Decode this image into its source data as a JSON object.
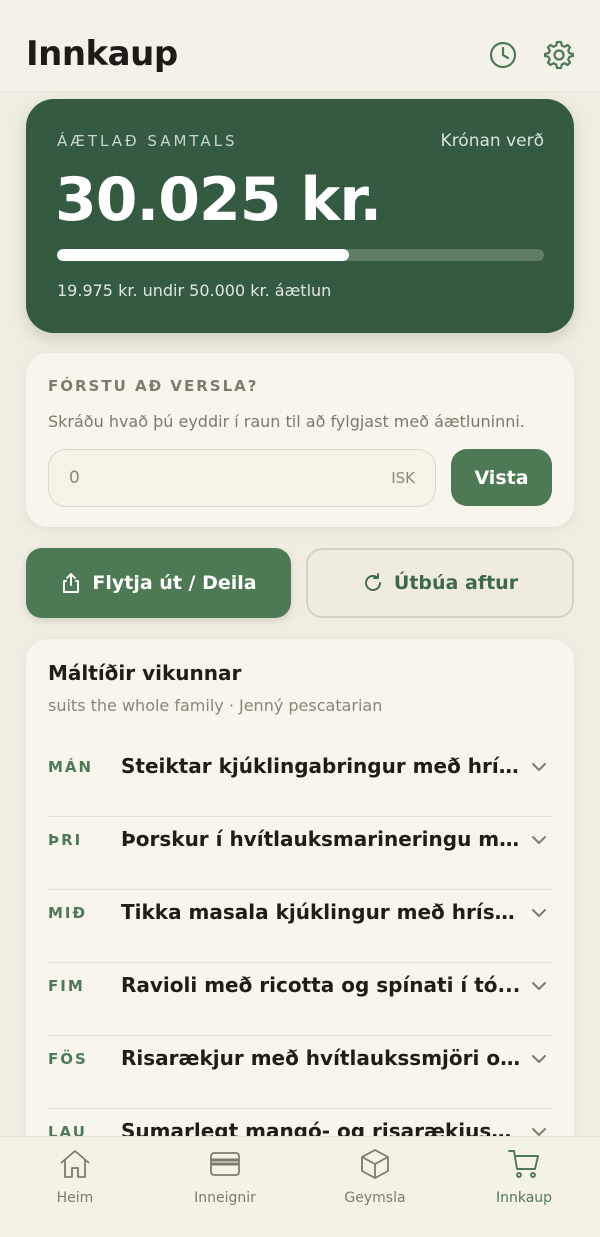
{
  "header": {
    "title": "Innkaup",
    "history_icon": "clock-icon",
    "settings_icon": "gear-icon"
  },
  "budget": {
    "label": "ÁÆTLAÐ SAMTALS",
    "store": "Krónan verð",
    "amount": "30.025 kr.",
    "progress_fraction": 0.6,
    "note": "19.975 kr. undir 50.000 kr. áætlun"
  },
  "spend": {
    "label": "FÓRSTU AÐ VERSLA?",
    "description": "Skráðu hvað þú eyddir í raun til að fylgjast með áætluninni.",
    "input_placeholder": "0",
    "unit": "ISK",
    "save_label": "Vista"
  },
  "actions": {
    "export_label": "Flytja út / Deila",
    "regenerate_label": "Útbúa aftur"
  },
  "meals": {
    "title": "Máltíðir vikunnar",
    "subtitle": "suits the whole family · Jenný pescatarian",
    "items": [
      {
        "day": "MÁN",
        "dish": "Steiktar kjúklingabringur með hrís..."
      },
      {
        "day": "ÞRI",
        "dish": "Þorskur í hvítlauksmarineringu m..."
      },
      {
        "day": "MIÐ",
        "dish": "Tikka masala kjúklingur með hrísg..."
      },
      {
        "day": "FIM",
        "dish": "Ravioli með ricotta og spínati í tó..."
      },
      {
        "day": "FÖS",
        "dish": "Risarækjur með hvítlaukssmjöri o..."
      },
      {
        "day": "LAU",
        "dish": "Sumarlegt mangó- og risarækjusa..."
      }
    ]
  },
  "nav": {
    "items": [
      {
        "label": "Heim",
        "icon": "home-icon",
        "active": false
      },
      {
        "label": "Inneignir",
        "icon": "card-icon",
        "active": false
      },
      {
        "label": "Geymsla",
        "icon": "box-icon",
        "active": false
      },
      {
        "label": "Innkaup",
        "icon": "cart-icon",
        "active": true
      }
    ]
  },
  "colors": {
    "accent": "#4d7a55",
    "budget_card": "#355a42",
    "background": "#f1ede2"
  }
}
